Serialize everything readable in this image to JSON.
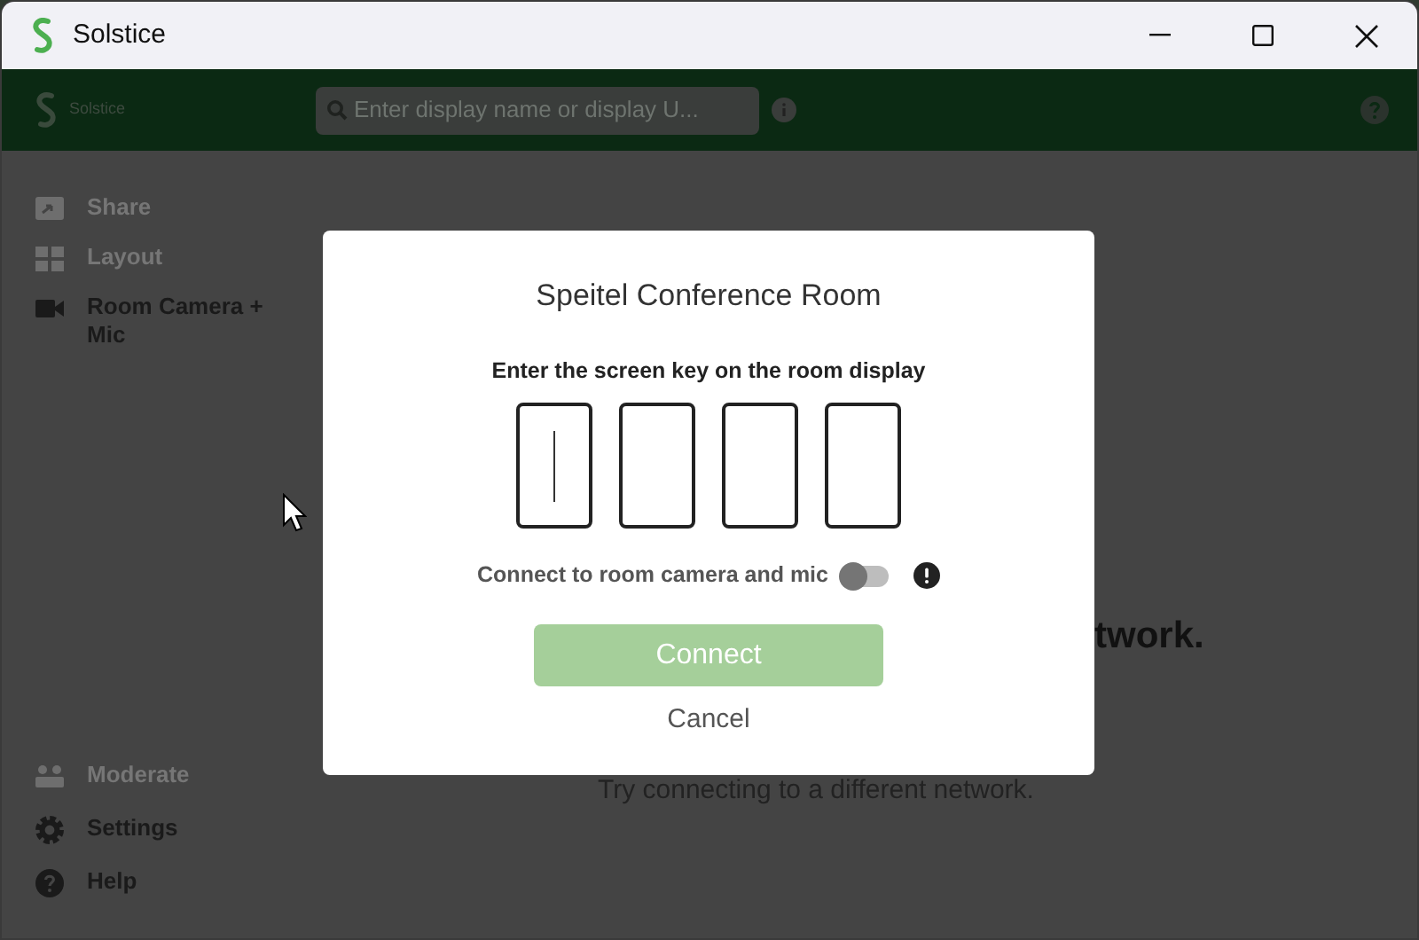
{
  "window": {
    "title": "Solstice"
  },
  "header": {
    "brand": "Solstice",
    "search": {
      "placeholder": "Enter display name or display U..."
    }
  },
  "sidebar": {
    "items": [
      {
        "label": "Share",
        "disabled": true
      },
      {
        "label": "Layout",
        "disabled": true
      },
      {
        "label": "Room Camera + Mic",
        "disabled": false
      }
    ],
    "bottom_items": [
      {
        "label": "Moderate",
        "disabled": true
      },
      {
        "label": "Settings",
        "disabled": false
      },
      {
        "label": "Help",
        "disabled": false
      }
    ]
  },
  "background": {
    "heading": "twork.",
    "message": "Try connecting to a different network."
  },
  "dialog": {
    "title": "Speitel Conference Room",
    "instruction": "Enter the screen key on the room display",
    "key_boxes": [
      {
        "focused": true
      },
      {
        "focused": false
      },
      {
        "focused": false
      },
      {
        "focused": false
      }
    ],
    "toggle": {
      "label": "Connect to room camera and mic",
      "on": false
    },
    "connect": {
      "label": "Connect",
      "disabled": true
    },
    "cancel": "Cancel"
  }
}
